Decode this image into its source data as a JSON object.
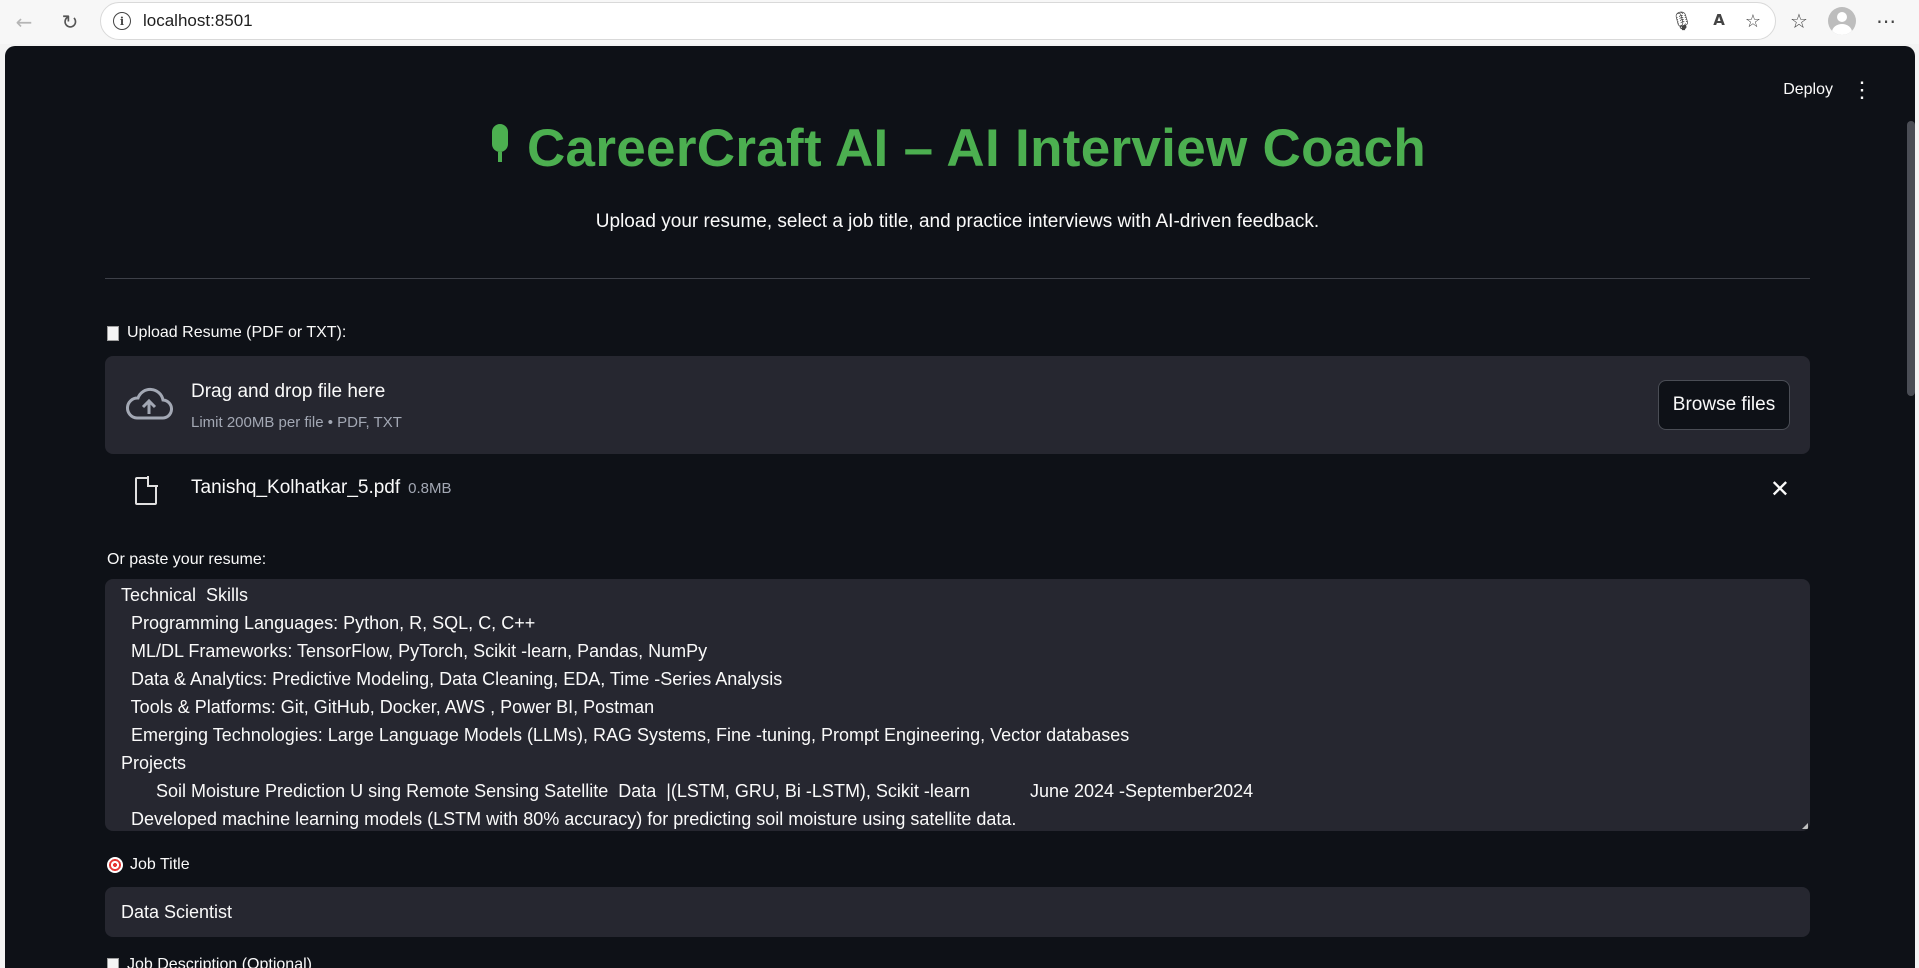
{
  "browser": {
    "url": "localhost:8501"
  },
  "app": {
    "deploy_label": "Deploy",
    "menu_icon": "kebab-menu-icon",
    "title": "CareerCraft AI – AI Interview Coach",
    "subtitle": "Upload your resume, select a job title, and practice interviews with AI-driven feedback.",
    "accent_color": "#4caf50"
  },
  "upload": {
    "label": "Upload Resume (PDF or TXT):",
    "dropzone_title": "Drag and drop file here",
    "dropzone_subtitle": "Limit 200MB per file • PDF, TXT",
    "browse_label": "Browse files",
    "file": {
      "name": "Tanishq_Kolhatkar_5.pdf",
      "size": "0.8MB"
    }
  },
  "paste": {
    "label": "Or paste your resume:",
    "lines": [
      "Technical  Skills",
      "  Programming Languages: Python, R, SQL, C, C++",
      "  ML/DL Frameworks: TensorFlow, PyTorch, Scikit -learn, Pandas, NumPy",
      "  Data & Analytics: Predictive Modeling, Data Cleaning, EDA, Time -Series Analysis",
      "  Tools & Platforms: Git, GitHub, Docker, AWS , Power BI, Postman",
      "  Emerging Technologies: Large Language Models (LLMs), RAG Systems, Fine -tuning, Prompt Engineering, Vector databases",
      "Projects",
      "       Soil Moisture Prediction U sing Remote Sensing Satellite  Data  |(LSTM, GRU, Bi -LSTM), Scikit -learn            June 2024 -September2024",
      "  Developed machine learning models (LSTM with 80% accuracy) for predicting soil moisture using satellite data."
    ]
  },
  "job": {
    "label": "Job Title",
    "value": "Data Scientist"
  },
  "partial_label": "Job Description (Optional)"
}
